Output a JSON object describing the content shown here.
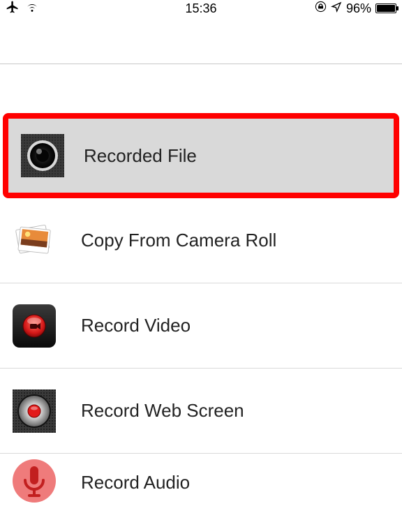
{
  "status_bar": {
    "time": "15:36",
    "battery_percent": "96%",
    "airplane_mode": true,
    "wifi": true,
    "location": true,
    "orientation_lock": true
  },
  "menu": {
    "items": [
      {
        "icon": "camera-lens-icon",
        "label": "Recorded File",
        "highlighted": true
      },
      {
        "icon": "photo-stack-icon",
        "label": "Copy From Camera Roll",
        "highlighted": false
      },
      {
        "icon": "record-video-icon",
        "label": "Record Video",
        "highlighted": false
      },
      {
        "icon": "record-web-icon",
        "label": "Record Web Screen",
        "highlighted": false
      },
      {
        "icon": "microphone-icon",
        "label": "Record Audio",
        "highlighted": false
      }
    ]
  }
}
